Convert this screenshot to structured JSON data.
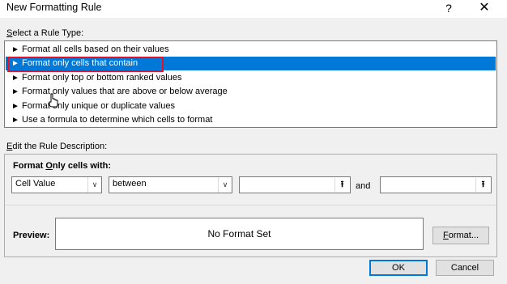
{
  "window": {
    "title": "New Formatting Rule",
    "help": "?",
    "close": "✕"
  },
  "select_rule_type": {
    "label_first": "S",
    "label_rest": "elect a Rule Type:",
    "selected_index": 1,
    "items": [
      {
        "label": "Format all cells based on their values"
      },
      {
        "label": "Format only cells that contain"
      },
      {
        "label": "Format only top or bottom ranked values"
      },
      {
        "label": "Format only values that are above or below average"
      },
      {
        "label": "Format only unique or duplicate values"
      },
      {
        "label": "Use a formula to determine which cells to format"
      }
    ],
    "arrow": "►"
  },
  "rule_description": {
    "label_first": "E",
    "label_rest": "dit the Rule Description:",
    "format_only_first": "O",
    "format_only_pre": "Format ",
    "format_only_rest": "nly cells with:",
    "condition_type": "Cell Value",
    "operator": "between",
    "value1": "",
    "value2": "",
    "and_label": "and",
    "ref_icon": "⭱",
    "chevron": "∨",
    "preview_label": "Preview:",
    "preview_text": "No Format Set",
    "format_button_first": "F",
    "format_button_rest": "ormat..."
  },
  "buttons": {
    "ok": "OK",
    "cancel": "Cancel"
  },
  "colors": {
    "selection": "#0078d7",
    "highlight_box": "#e81123"
  }
}
